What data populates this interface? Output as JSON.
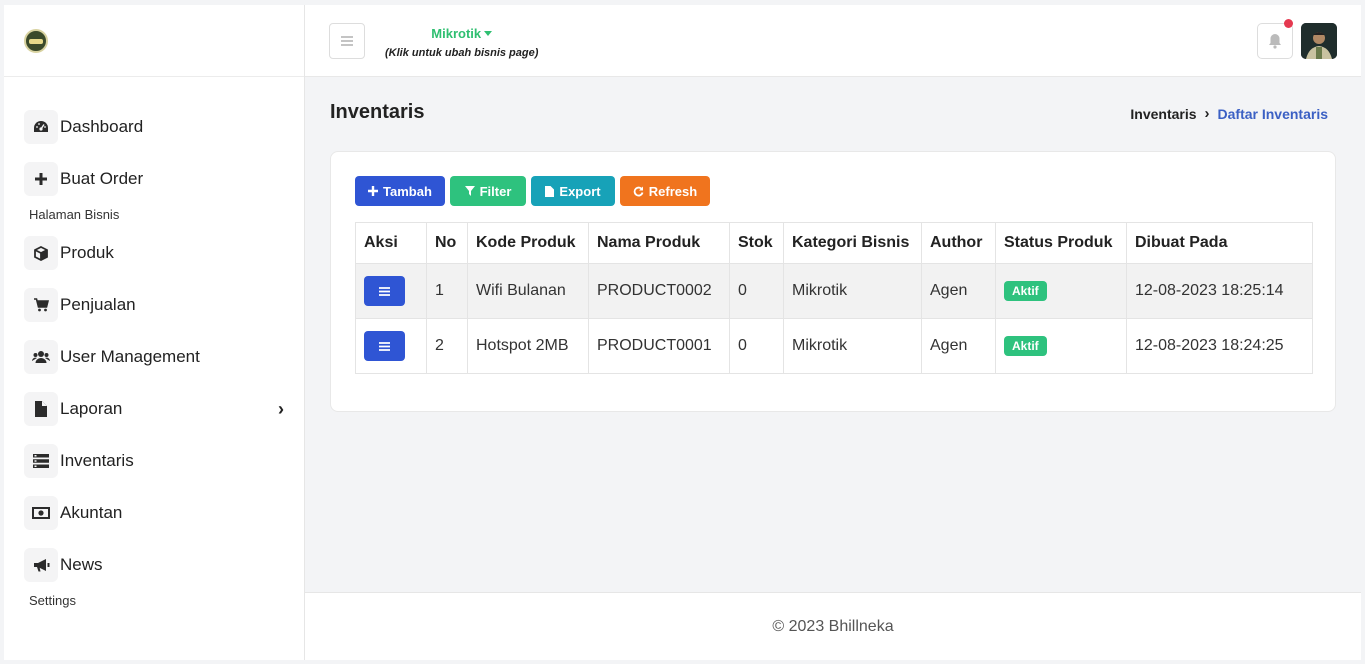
{
  "sidebar": {
    "items": [
      {
        "label": "Dashboard",
        "icon": "dashboard-icon"
      },
      {
        "label": "Buat Order",
        "icon": "plus-icon"
      }
    ],
    "section1": "Halaman Bisnis",
    "items2": [
      {
        "label": "Produk",
        "icon": "cube-icon"
      },
      {
        "label": "Penjualan",
        "icon": "cart-icon"
      },
      {
        "label": "User Management",
        "icon": "users-icon"
      },
      {
        "label": "Laporan",
        "icon": "file-icon"
      },
      {
        "label": "Inventaris",
        "icon": "list-icon"
      },
      {
        "label": "Akuntan",
        "icon": "money-icon"
      },
      {
        "label": "News",
        "icon": "megaphone-icon"
      }
    ],
    "section2": "Settings"
  },
  "header": {
    "business_name": "Mikrotik",
    "business_hint": "(Klik untuk ubah bisnis page)"
  },
  "page": {
    "title": "Inventaris",
    "breadcrumb": [
      "Inventaris",
      "Daftar Inventaris"
    ]
  },
  "toolbar": {
    "add": "Tambah",
    "filter": "Filter",
    "export": "Export",
    "refresh": "Refresh"
  },
  "table": {
    "headers": [
      "Aksi",
      "No",
      "Kode Produk",
      "Nama Produk",
      "Stok",
      "Kategori Bisnis",
      "Author",
      "Status Produk",
      "Dibuat Pada"
    ],
    "rows": [
      {
        "no": "1",
        "kode": "Wifi Bulanan",
        "nama": "PRODUCT0002",
        "stok": "0",
        "kategori": "Mikrotik",
        "author": "Agen",
        "status": "Aktif",
        "dibuat": "12-08-2023 18:25:14"
      },
      {
        "no": "2",
        "kode": "Hotspot 2MB",
        "nama": "PRODUCT0001",
        "stok": "0",
        "kategori": "Mikrotik",
        "author": "Agen",
        "status": "Aktif",
        "dibuat": "12-08-2023 18:24:25"
      }
    ]
  },
  "footer": "© 2023 Bhillneka",
  "colors": {
    "primary": "#2f55d4",
    "success": "#2ec27e",
    "info": "#17a2b8",
    "warning": "#f0741e",
    "link": "#3b60c4"
  }
}
